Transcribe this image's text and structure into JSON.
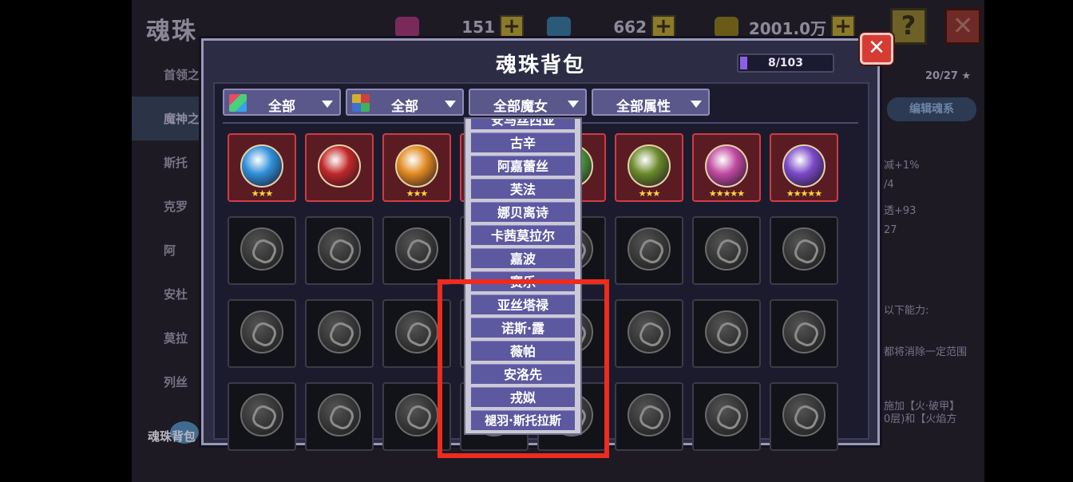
{
  "background": {
    "title": "魂珠",
    "resources": [
      {
        "value": "151",
        "icon": "pink-gem-icon",
        "color": "#c03a8a"
      },
      {
        "value": "662",
        "icon": "blue-diamond-icon",
        "color": "#3a8ab0"
      },
      {
        "value": "2001.0万",
        "icon": "gold-chest-icon",
        "color": "#a08420"
      }
    ],
    "help_label": "?",
    "close_label": "✕",
    "side_items": [
      "首领之",
      "魔神之",
      "斯托",
      "克罗",
      "阿",
      "安杜",
      "莫拉",
      "列丝"
    ],
    "bag_label": "魂珠背包",
    "right_panel": {
      "progress": "20/27 ★",
      "tab": "编辑魂系",
      "lines": [
        "减+1%",
        "/4",
        "透+93",
        "27",
        "以下能力:",
        "都将消除一定范围",
        "施加【火·破甲】",
        "0层)和【火焰方"
      ]
    }
  },
  "modal": {
    "title": "魂珠背包",
    "capacity": "8/103",
    "capacity_fraction": 0.078,
    "close_label": "✕",
    "filters": [
      {
        "label": "全部",
        "icon": "rainbow-element-icon"
      },
      {
        "label": "全部",
        "icon": "quad-color-icon"
      },
      {
        "label": "全部魔女",
        "icon": ""
      },
      {
        "label": "全部属性",
        "icon": ""
      }
    ]
  },
  "grid": {
    "rows": [
      [
        {
          "owned": true,
          "stars": "★★★",
          "color": "#2f8fd8"
        },
        {
          "owned": true,
          "stars": "",
          "color": "#c02828"
        },
        {
          "owned": true,
          "stars": "★★★",
          "color": "#e08a20"
        },
        {
          "owned": true,
          "stars": "",
          "color": "#a04a30"
        },
        {
          "owned": true,
          "stars": "",
          "color": "#4a9a3a"
        },
        {
          "owned": true,
          "stars": "★★★",
          "color": "#6a8a2a"
        },
        {
          "owned": true,
          "stars": "★★★★★",
          "color": "#c04aa0"
        },
        {
          "owned": true,
          "stars": "★★★★★",
          "color": "#7a4ac8"
        }
      ],
      [
        {
          "owned": false
        },
        {
          "owned": false
        },
        {
          "owned": false
        },
        {
          "owned": false
        },
        {
          "owned": false
        },
        {
          "owned": false
        },
        {
          "owned": false
        },
        {
          "owned": false
        }
      ],
      [
        {
          "owned": false
        },
        {
          "owned": false
        },
        {
          "owned": false
        },
        {
          "owned": false
        },
        {
          "owned": false
        },
        {
          "owned": false
        },
        {
          "owned": false
        },
        {
          "owned": false
        }
      ],
      [
        {
          "owned": false
        },
        {
          "owned": false
        },
        {
          "owned": false
        },
        {
          "owned": false
        },
        {
          "owned": false
        },
        {
          "owned": false
        },
        {
          "owned": false
        },
        {
          "owned": false
        }
      ]
    ]
  },
  "dropdown": {
    "items": [
      "安马丝西亚",
      "古辛",
      "阿嘉蕾丝",
      "芙法",
      "娜贝离诗",
      "卡茜莫拉尔",
      "嘉波",
      "赛乐",
      "亚丝塔禄",
      "诺斯·露",
      "薇帕",
      "安洛先",
      "戎姒",
      "褪羽·斯托拉斯"
    ]
  }
}
